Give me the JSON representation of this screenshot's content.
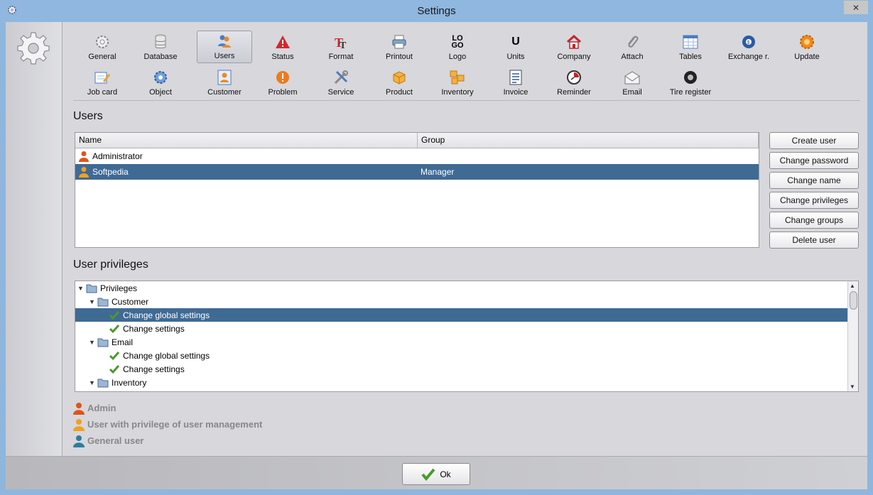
{
  "window": {
    "title": "Settings",
    "close_glyph": "✕"
  },
  "toolbar": {
    "row1": [
      {
        "label": "General",
        "icon": "gear-icon"
      },
      {
        "label": "Database",
        "icon": "database-icon"
      },
      {
        "label": "Users",
        "icon": "users-icon",
        "active": true
      },
      {
        "label": "Status",
        "icon": "warning-icon"
      },
      {
        "label": "Format",
        "icon": "format-icon"
      },
      {
        "label": "Printout",
        "icon": "printer-icon"
      },
      {
        "label": "Logo",
        "icon": "logo-icon"
      },
      {
        "label": "Units",
        "icon": "units-icon"
      },
      {
        "label": "Company",
        "icon": "company-icon"
      },
      {
        "label": "Attach",
        "icon": "paperclip-icon"
      },
      {
        "label": "Tables",
        "icon": "table-icon"
      },
      {
        "label": "Exchange r.",
        "icon": "exchange-icon"
      },
      {
        "label": "Update",
        "icon": "update-icon"
      }
    ],
    "row2": [
      {
        "label": "Job card",
        "icon": "job-card-icon"
      },
      {
        "label": "Object",
        "icon": "object-icon"
      },
      {
        "label": "Customer",
        "icon": "customer-icon"
      },
      {
        "label": "Problem",
        "icon": "problem-icon"
      },
      {
        "label": "Service",
        "icon": "tools-icon"
      },
      {
        "label": "Product",
        "icon": "product-box-icon"
      },
      {
        "label": "Inventory",
        "icon": "inventory-icon"
      },
      {
        "label": "Invoice",
        "icon": "invoice-icon"
      },
      {
        "label": "Reminder",
        "icon": "clock-icon"
      },
      {
        "label": "Email",
        "icon": "email-icon"
      },
      {
        "label": "Tire register",
        "icon": "tire-icon"
      }
    ],
    "logo_text": "LO\nGO",
    "units_text": "U"
  },
  "users": {
    "heading": "Users",
    "columns": [
      "Name",
      "Group"
    ],
    "rows": [
      {
        "name": "Administrator",
        "group": "",
        "type": "admin"
      },
      {
        "name": "Softpedia",
        "group": "Manager",
        "type": "manager",
        "selected": true
      }
    ],
    "buttons": [
      "Create user",
      "Change password",
      "Change name",
      "Change privileges",
      "Change groups",
      "Delete user"
    ]
  },
  "privileges": {
    "heading": "User privileges",
    "tree": [
      {
        "label": "Privileges",
        "level": 0,
        "kind": "folder",
        "expanded": true
      },
      {
        "label": "Customer",
        "level": 1,
        "kind": "folder",
        "expanded": true
      },
      {
        "label": "Change global settings",
        "level": 2,
        "kind": "check",
        "selected": true
      },
      {
        "label": "Change settings",
        "level": 2,
        "kind": "check"
      },
      {
        "label": "Email",
        "level": 1,
        "kind": "folder",
        "expanded": true
      },
      {
        "label": "Change global settings",
        "level": 2,
        "kind": "check"
      },
      {
        "label": "Change settings",
        "level": 2,
        "kind": "check"
      },
      {
        "label": "Inventory",
        "level": 1,
        "kind": "folder",
        "expanded": true
      }
    ]
  },
  "legend": [
    {
      "label": "Admin",
      "color": "#e0531c"
    },
    {
      "label": "User with privilege of user management",
      "color": "#f0a020"
    },
    {
      "label": "General user",
      "color": "#2e7d9c"
    }
  ],
  "footer": {
    "ok_label": "Ok"
  },
  "colors": {
    "selection": "#3f6a94",
    "admin": "#e0531c",
    "manager": "#f0a020",
    "general": "#2e7d9c",
    "check": "#4a9a2a"
  }
}
